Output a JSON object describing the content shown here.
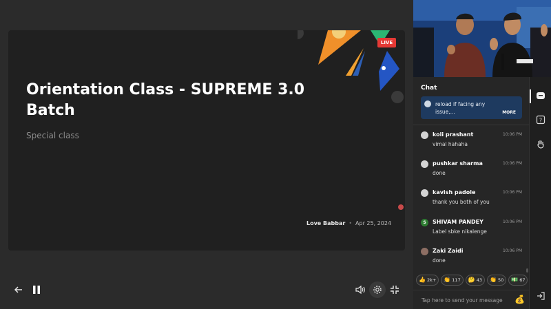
{
  "slide": {
    "title": "Orientation Class - SUPREME 3.0 Batch",
    "subtitle": "Special class",
    "author": "Love Babbar",
    "date": "Apr 25, 2024",
    "live_label": "LIVE"
  },
  "controls": {
    "back_icon": "back-arrow-icon",
    "pause_icon": "pause-icon",
    "volume_icon": "volume-icon",
    "settings_icon": "gear-icon",
    "exit_fullscreen_icon": "minimize-icon"
  },
  "chat": {
    "heading": "Chat",
    "pinned": {
      "text": "reload if facing any issue,...",
      "more": "MORE"
    },
    "messages": [
      {
        "user": "koli prashant",
        "time": "10:06 PM",
        "text": "vimal hahaha"
      },
      {
        "user": "pushkar sharma",
        "time": "10:06 PM",
        "text": "done"
      },
      {
        "user": "kavish padole",
        "time": "10:06 PM",
        "text": "thank you both of you"
      },
      {
        "user": "SHIVAM PANDEY",
        "time": "10:06 PM",
        "text": "Label sbke nikalenge",
        "avatar_letter": "S"
      },
      {
        "user": "Zaki Zaidi",
        "time": "10:06 PM",
        "text": "done"
      }
    ],
    "reactions": [
      {
        "emoji": "👍",
        "count": "2k+"
      },
      {
        "emoji": "👏",
        "count": "117"
      },
      {
        "emoji": "🤔",
        "count": "43"
      },
      {
        "emoji": "👏",
        "count": "50"
      },
      {
        "emoji": "💵",
        "count": "67"
      }
    ],
    "composer_placeholder": "Tap here to send your message"
  },
  "side_icons": [
    "chat-icon",
    "question-icon",
    "raise-hand-icon",
    "logout-icon"
  ],
  "colors": {
    "live": "#e53935",
    "pinned_bg": "#1e3a5f",
    "accent_green": "#2e7d32"
  }
}
